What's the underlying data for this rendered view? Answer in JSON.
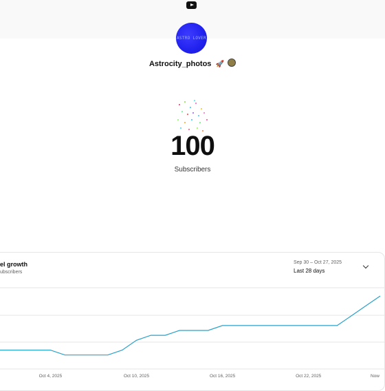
{
  "header": {
    "logo_icon": "youtube-play-icon"
  },
  "channel": {
    "avatar_text": "ASTRO LOVER",
    "name": "Astrocity_photos",
    "badges": [
      "rocket-icon",
      "coin-icon"
    ],
    "rocket_glyph": "🚀"
  },
  "subscribers": {
    "count": "100",
    "label": "Subscribers"
  },
  "growth_card": {
    "title": "el growth",
    "subtitle": "ubscribers",
    "range_dates": "Sep 30 – Oct 27, 2025",
    "range_label": "Last 28 days",
    "dropdown_icon": "chevron-down-icon"
  },
  "chart_data": {
    "type": "line",
    "x": [
      "Sep 30",
      "Oct 1",
      "Oct 2",
      "Oct 3",
      "Oct 4",
      "Oct 5",
      "Oct 6",
      "Oct 7",
      "Oct 8",
      "Oct 9",
      "Oct 10",
      "Oct 11",
      "Oct 12",
      "Oct 13",
      "Oct 14",
      "Oct 15",
      "Oct 16",
      "Oct 17",
      "Oct 18",
      "Oct 19",
      "Oct 20",
      "Oct 21",
      "Oct 22",
      "Oct 23",
      "Oct 24",
      "Oct 25",
      "Oct 26",
      "Oct 27"
    ],
    "tick_labels": [
      "Oct 4, 2025",
      "Oct 10, 2025",
      "Oct 16, 2025",
      "Oct 22, 2025",
      "Now"
    ],
    "series": [
      {
        "color": "#2aa1c8",
        "values": [
          75,
          75,
          75,
          75,
          75,
          74,
          74,
          74,
          74,
          75,
          77,
          78,
          78,
          79,
          79,
          79,
          80,
          80,
          80,
          80,
          80,
          80,
          80,
          80,
          80,
          82,
          84,
          86
        ]
      }
    ],
    "ylim": [
      72,
      86
    ],
    "grid": true,
    "colors": {
      "line": "#2aa1c8",
      "grid": "#e5e5e5"
    }
  }
}
